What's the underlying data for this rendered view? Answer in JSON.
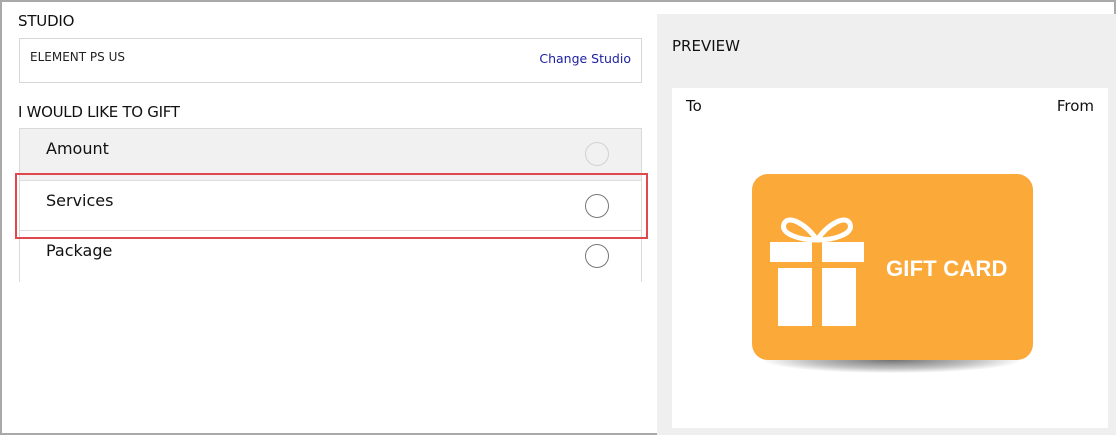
{
  "studio": {
    "heading": "STUDIO",
    "name": "ELEMENT PS US",
    "change_link": "Change Studio"
  },
  "gift": {
    "heading": "I WOULD LIKE TO GIFT",
    "options": [
      {
        "label": "Amount",
        "selected": false,
        "disabled_look": true
      },
      {
        "label": "Services",
        "selected": false,
        "highlighted": true
      },
      {
        "label": "Package",
        "selected": false
      }
    ]
  },
  "preview": {
    "heading": "PREVIEW",
    "to_label": "To",
    "from_label": "From",
    "card_text": "GIFT CARD",
    "card_icon": "gift-icon"
  },
  "colors": {
    "card": "#fba939",
    "highlight_border": "#e0484b",
    "link": "#1b1fa0",
    "preview_bg": "#efefef"
  }
}
